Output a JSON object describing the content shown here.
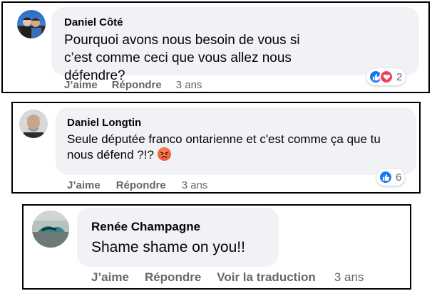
{
  "comments": [
    {
      "author": "Daniel Côté",
      "text": "Pourquoi avons nous besoin de vous si c’est comme ceci que vous allez nous défendre?",
      "actions": {
        "like": "J’aime",
        "reply": "Répondre",
        "time": "3 ans"
      },
      "reactions": {
        "icons": [
          "like-icon",
          "love-icon"
        ],
        "count": "2",
        "like_color": "#1877f2",
        "love_color": "#f33e58"
      }
    },
    {
      "author": "Daniel Longtin",
      "text": "Seule députée franco ontarienne et c'est comme ça que tu nous défend ?!?",
      "emoji": "angry-face-icon",
      "actions": {
        "like": "J’aime",
        "reply": "Répondre",
        "time": "3 ans"
      },
      "reactions": {
        "icons": [
          "like-icon"
        ],
        "count": "6",
        "like_color": "#1877f2"
      }
    },
    {
      "author": "Renée Champagne",
      "text": "Shame shame on you!!",
      "actions": {
        "like": "J’aime",
        "reply": "Répondre",
        "translate": "Voir la traduction",
        "time": "3 ans"
      }
    }
  ]
}
